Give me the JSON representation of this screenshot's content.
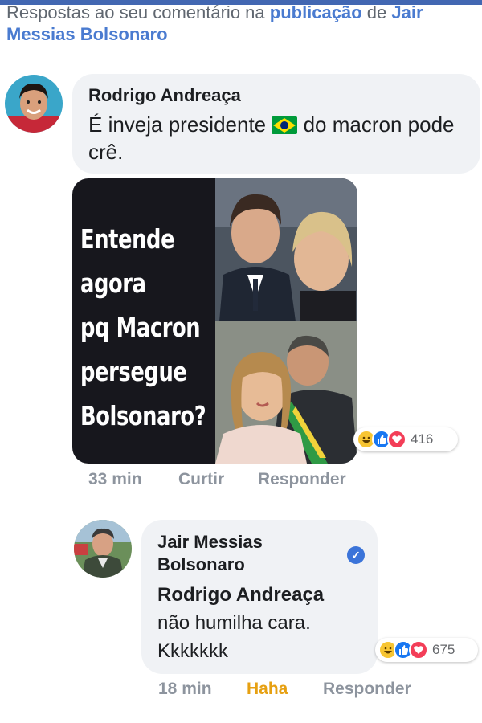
{
  "header": {
    "prefix": "Respostas ao seu comentário na ",
    "link1": "publicação",
    "mid": " de ",
    "link2": "Jair Messias Bolsonaro"
  },
  "comment1": {
    "author": "Rodrigo Andreaça",
    "text_before_flag": "É inveja presidente ",
    "flag_icon": "brazil-flag-emoji",
    "text_after_flag": " do macron pode crê.",
    "meme_lines": [
      "Entende",
      "agora",
      "pq Macron",
      "persegue",
      "Bolsonaro?"
    ],
    "reaction_icons": [
      "haha-reaction-icon",
      "like-reaction-icon",
      "love-reaction-icon"
    ],
    "reaction_count": "416",
    "time": "33 min",
    "like_label": "Curtir",
    "reply_label": "Responder"
  },
  "comment2": {
    "author": "Jair Messias Bolsonaro",
    "verified_icon": "verified-badge-icon",
    "mention": "Rodrigo Andreaça",
    "text_line1": "não humilha cara.",
    "text_line2": "Kkkkkkk",
    "reaction_icons": [
      "haha-reaction-icon",
      "like-reaction-icon",
      "love-reaction-icon"
    ],
    "reaction_count": "675",
    "time": "18 min",
    "haha_label": "Haha",
    "reply_label": "Responder"
  },
  "colors": {
    "link": "#4a7bd0",
    "bubble": "#f0f2f5",
    "haha_active": "#e6a012",
    "meta_gray": "#8d949e"
  }
}
